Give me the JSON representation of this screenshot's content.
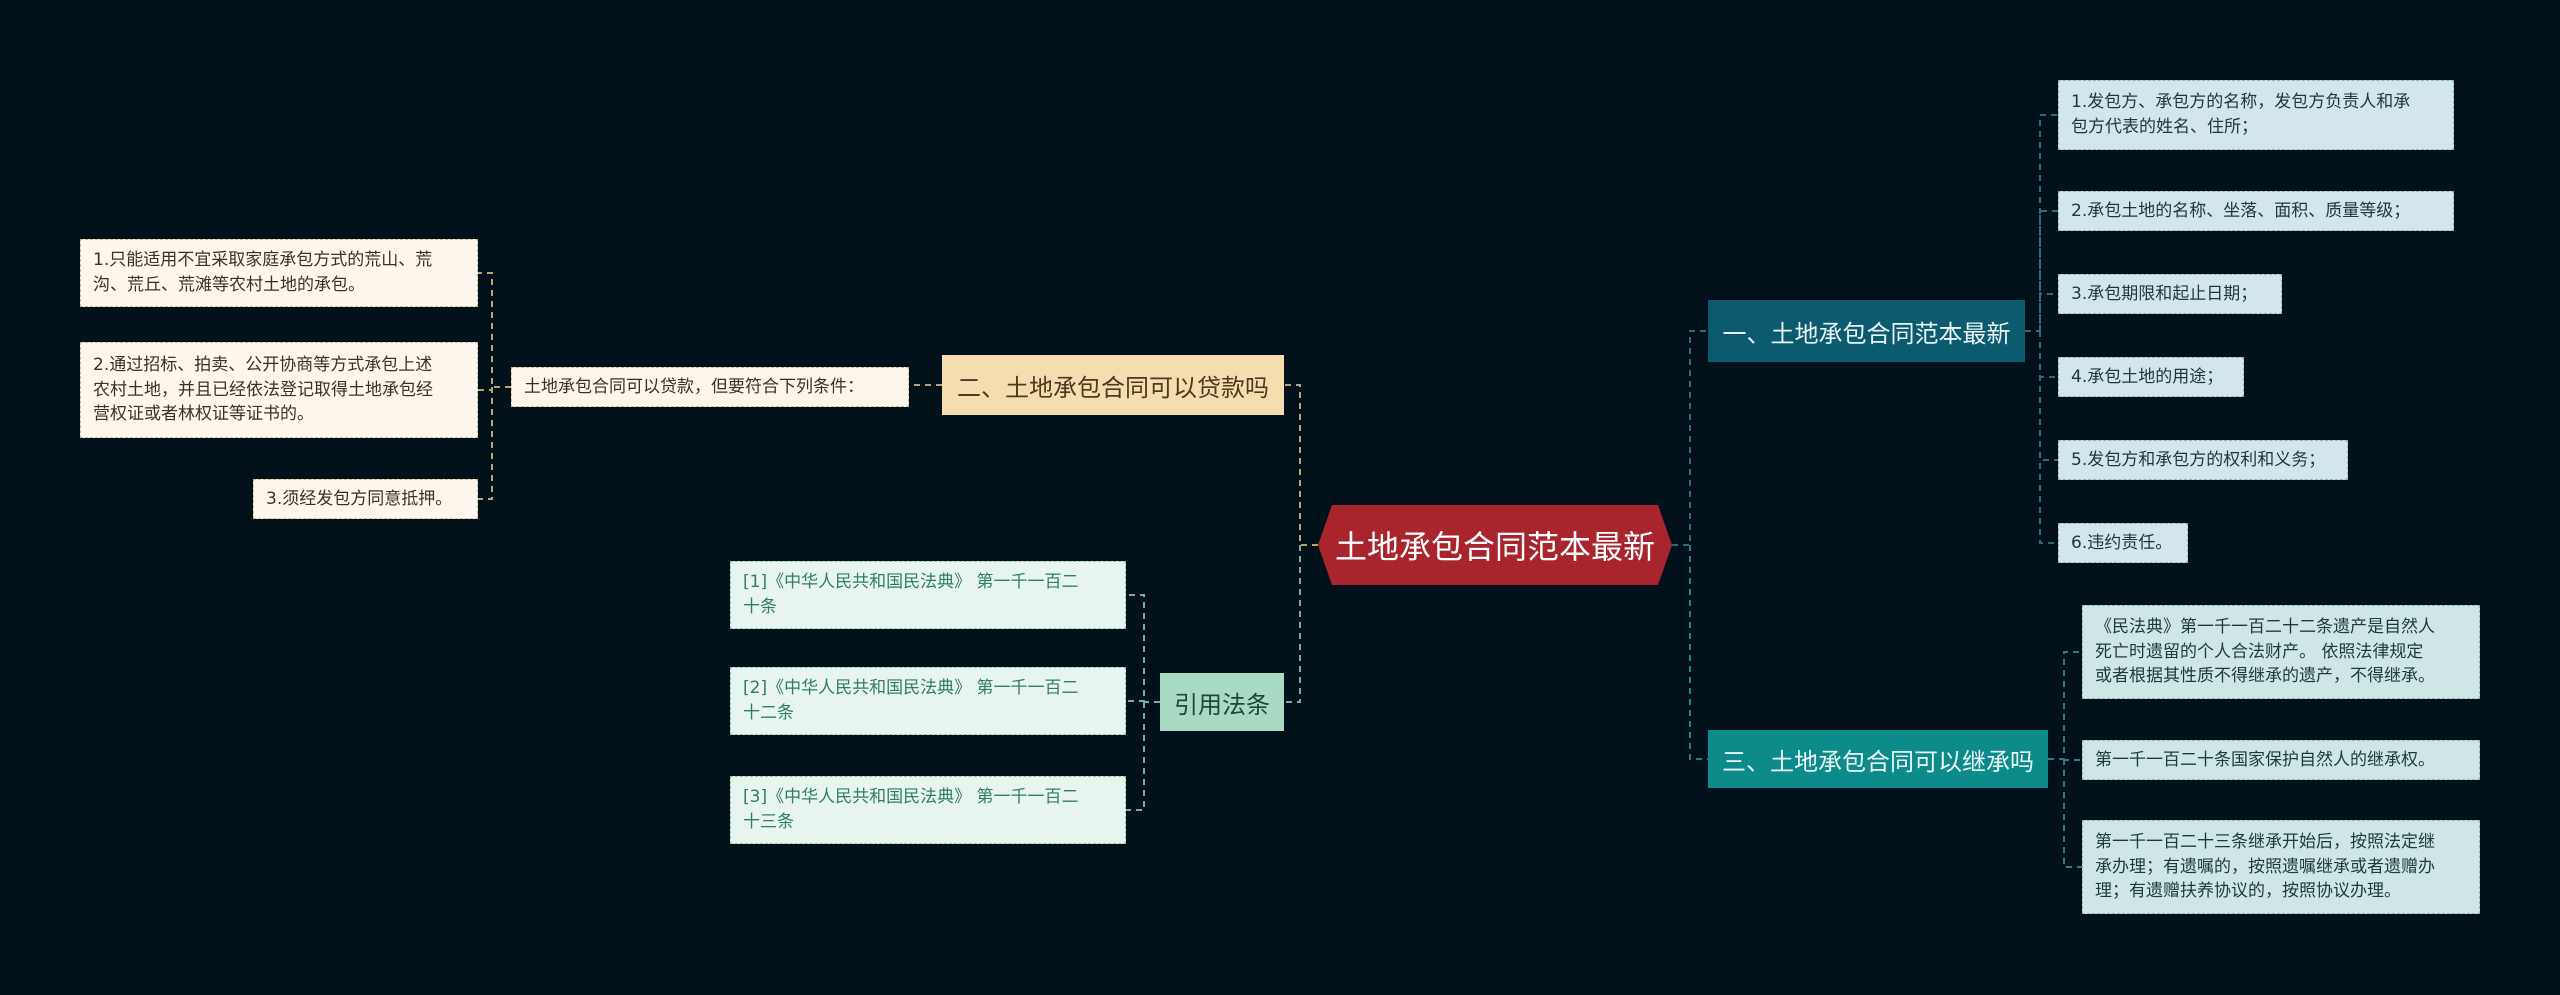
{
  "root": {
    "label": "土地承包合同范本最新"
  },
  "branches": {
    "b1": {
      "label": "一、土地承包合同范本最新",
      "items": [
        "1.发包方、承包方的名称，发包方负责人和承\n包方代表的姓名、住所；",
        "2.承包土地的名称、坐落、面积、质量等级；",
        "3.承包期限和起止日期；",
        "4.承包土地的用途；",
        "5.发包方和承包方的权利和义务；",
        "6.违约责任。"
      ]
    },
    "b2": {
      "label": "二、土地承包合同可以贷款吗",
      "mid": "土地承包合同可以贷款，但要符合下列条件：",
      "items": [
        "1.只能适用不宜采取家庭承包方式的荒山、荒\n沟、荒丘、荒滩等农村土地的承包。",
        "2.通过招标、拍卖、公开协商等方式承包上述\n农村土地，并且已经依法登记取得土地承包经\n营权证或者林权证等证书的。",
        "3.须经发包方同意抵押。"
      ]
    },
    "b3": {
      "label": "三、土地承包合同可以继承吗",
      "items": [
        "《民法典》第一千一百二十二条遗产是自然人\n死亡时遗留的个人合法财产。 依照法律规定\n或者根据其性质不得继承的遗产，不得继承。",
        "第一千一百二十条国家保护自然人的继承权。",
        "第一千一百二十三条继承开始后，按照法定继\n承办理；有遗嘱的，按照遗嘱继承或者遗赠办\n理；有遗赠扶养协议的，按照协议办理。"
      ]
    },
    "b4": {
      "label": "引用法条",
      "items": [
        "[1]《中华人民共和国民法典》 第一千一百二\n十条",
        "[2]《中华人民共和国民法典》 第一千一百二\n十二条",
        "[3]《中华人民共和国民法典》 第一千一百二\n十三条"
      ]
    }
  },
  "colors": {
    "background": "#03111a",
    "root": "#a8252e",
    "branch1": "#0c5a6d",
    "branch2": "#f5ddb0",
    "branch3": "#0d8a8a",
    "branch4": "#a8dac4"
  }
}
